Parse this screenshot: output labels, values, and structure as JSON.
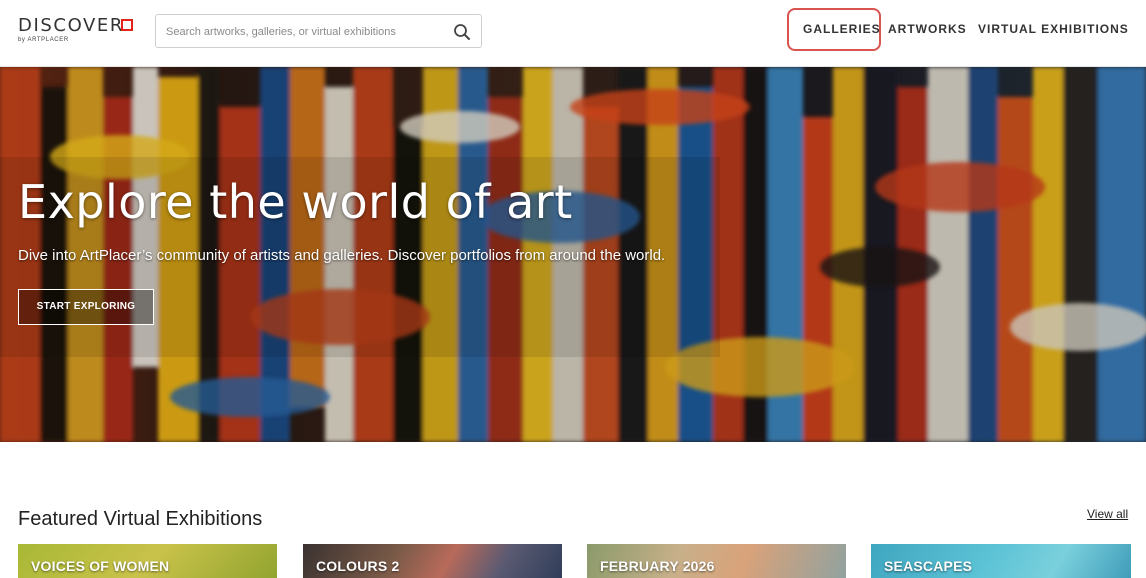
{
  "header": {
    "logo_text": "DISCOVER",
    "logo_sub": "by ARTPLACER",
    "search_placeholder": "Search artworks, galleries, or virtual exhibitions",
    "nav": [
      "GALLERIES",
      "ARTWORKS",
      "VIRTUAL EXHIBITIONS"
    ],
    "highlight_color": "#d9534f"
  },
  "hero": {
    "title": "Explore the world of art",
    "subtitle": "Dive into ArtPlacer’s community of artists and galleries. Discover portfolios from around the world.",
    "button": "START EXPLORING"
  },
  "featured": {
    "title": "Featured Virtual Exhibitions",
    "view_all": "View all",
    "cards": [
      {
        "label": "VOICES OF WOMEN"
      },
      {
        "label": "COLOURS 2"
      },
      {
        "label": "FEBRUARY 2026"
      },
      {
        "label": "SEASCAPES"
      }
    ]
  },
  "icons": {
    "search": "search-icon",
    "logo_mark": "red-square-icon"
  }
}
